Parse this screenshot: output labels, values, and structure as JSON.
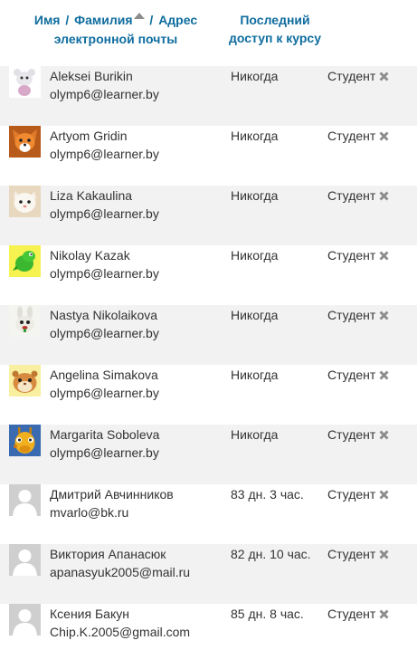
{
  "header": {
    "first_name": "Имя",
    "slash1": "/",
    "last_name": "Фамилия",
    "slash2": "/",
    "email": "Адрес электронной почты",
    "last_access": "Последний доступ к курсу"
  },
  "users": [
    {
      "name": "Aleksei Burikin",
      "email": "olymp6@learner.by",
      "access": "Никогда",
      "role": "Студент",
      "avatar": "cartoon-animal-avatar"
    },
    {
      "name": "Artyom Gridin",
      "email": "olymp6@learner.by",
      "access": "Никогда",
      "role": "Студент",
      "avatar": "fox-avatar"
    },
    {
      "name": "Liza Kakaulina",
      "email": "olymp6@learner.by",
      "access": "Никогда",
      "role": "Студент",
      "avatar": "cat-avatar"
    },
    {
      "name": "Nikolay Kazak",
      "email": "olymp6@learner.by",
      "access": "Никогда",
      "role": "Студент",
      "avatar": "dinosaur-avatar"
    },
    {
      "name": "Nastya Nikolaikova",
      "email": "olymp6@learner.by",
      "access": "Никогда",
      "role": "Студент",
      "avatar": "rabbit-avatar"
    },
    {
      "name": "Angelina Simakova",
      "email": "olymp6@learner.by",
      "access": "Никогда",
      "role": "Студент",
      "avatar": "hamster-avatar"
    },
    {
      "name": "Margarita Soboleva",
      "email": "olymp6@learner.by",
      "access": "Никогда",
      "role": "Студент",
      "avatar": "giraffe-avatar"
    },
    {
      "name": "Дмитрий Авчинников",
      "email": "mvarlo@bk.ru",
      "access": "83 дн. 3 час.",
      "role": "Студент",
      "avatar": "default-user-avatar"
    },
    {
      "name": "Виктория Апанасюк",
      "email": "apanasyuk2005@mail.ru",
      "access": "82 дн. 10 час.",
      "role": "Студент",
      "avatar": "default-user-avatar"
    },
    {
      "name": "Ксения Бакун",
      "email": "Chip.K.2005@gmail.com",
      "access": "85 дн. 8 час.",
      "role": "Студент",
      "avatar": "default-user-avatar"
    }
  ],
  "icons": {
    "sort": "sort-asc-icon",
    "remove": "remove-role-icon"
  },
  "colors": {
    "header_link": "#0f6d9f",
    "row_stripe": "#f2f2f2",
    "text": "#333333",
    "remove_icon": "#8c8c8c"
  }
}
